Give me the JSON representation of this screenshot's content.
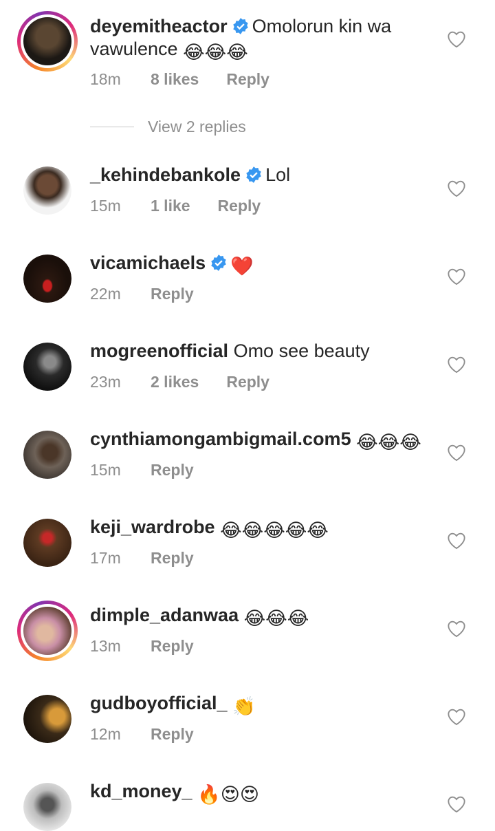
{
  "comments": [
    {
      "user": "deyemitheactor",
      "verified": true,
      "text": "Omolorun kin wa vawulence",
      "emoji": "😂😂😂",
      "time": "18m",
      "likes": "8 likes",
      "reply": "Reply",
      "ring": true
    },
    {
      "user": "_kehindebankole",
      "verified": true,
      "text": "Lol",
      "emoji": "",
      "time": "15m",
      "likes": "1 like",
      "reply": "Reply",
      "ring": false
    },
    {
      "user": "vicamichaels",
      "verified": true,
      "text": "",
      "emoji": "❤️",
      "time": "22m",
      "likes": "",
      "reply": "Reply",
      "ring": false
    },
    {
      "user": "mogreenofficial",
      "verified": false,
      "text": "Omo see beauty",
      "emoji": "",
      "time": "23m",
      "likes": "2 likes",
      "reply": "Reply",
      "ring": false
    },
    {
      "user": "cynthiamongambigmail.com5",
      "verified": false,
      "text": "",
      "emoji": "😂😂😂",
      "time": "15m",
      "likes": "",
      "reply": "Reply",
      "ring": false
    },
    {
      "user": "keji_wardrobe",
      "verified": false,
      "text": "",
      "emoji": "😂😂😂😂😂",
      "time": "17m",
      "likes": "",
      "reply": "Reply",
      "ring": false
    },
    {
      "user": "dimple_adanwaa",
      "verified": false,
      "text": "",
      "emoji": "😂😂😂",
      "time": "13m",
      "likes": "",
      "reply": "Reply",
      "ring": true
    },
    {
      "user": "gudboyofficial_",
      "verified": false,
      "text": "",
      "emoji": "👏",
      "time": "12m",
      "likes": "",
      "reply": "Reply",
      "ring": false
    },
    {
      "user": "kd_money_",
      "verified": false,
      "text": "",
      "emoji": "🔥😍😍",
      "time": "",
      "likes": "",
      "reply": "",
      "ring": false
    }
  ],
  "view_replies": "View 2 replies",
  "colors": {
    "verified": "#3897f0",
    "meta": "#8e8e8e",
    "text": "#262626"
  }
}
